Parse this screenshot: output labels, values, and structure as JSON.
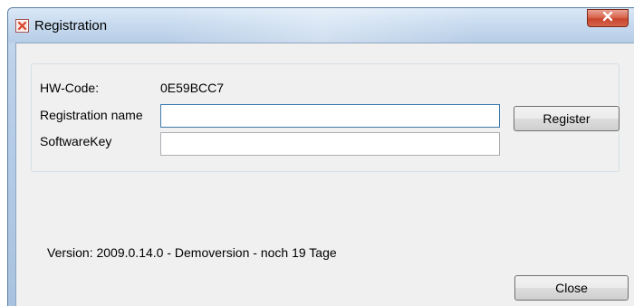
{
  "window": {
    "title": "Registration",
    "app_icon": "app-close-red-icon",
    "close_icon": "close-icon"
  },
  "form": {
    "hw_code_label": "HW-Code:",
    "hw_code_value": "0E59BCC7",
    "registration_name_label": "Registration name",
    "registration_name_value": "",
    "software_key_label": "SoftwareKey",
    "software_key_value": "",
    "register_button": "Register"
  },
  "footer": {
    "version_prefix": "Version: ",
    "version_number": "2009.0.14.0",
    "separator": " - ",
    "demo_text": "Demoversion - noch 19 Tage",
    "close_button": "Close"
  },
  "colors": {
    "titlebar": "#c8dbef",
    "client_background": "#f0f0f0",
    "close_button": "#c8452b",
    "focused_border": "#3d7bad"
  }
}
